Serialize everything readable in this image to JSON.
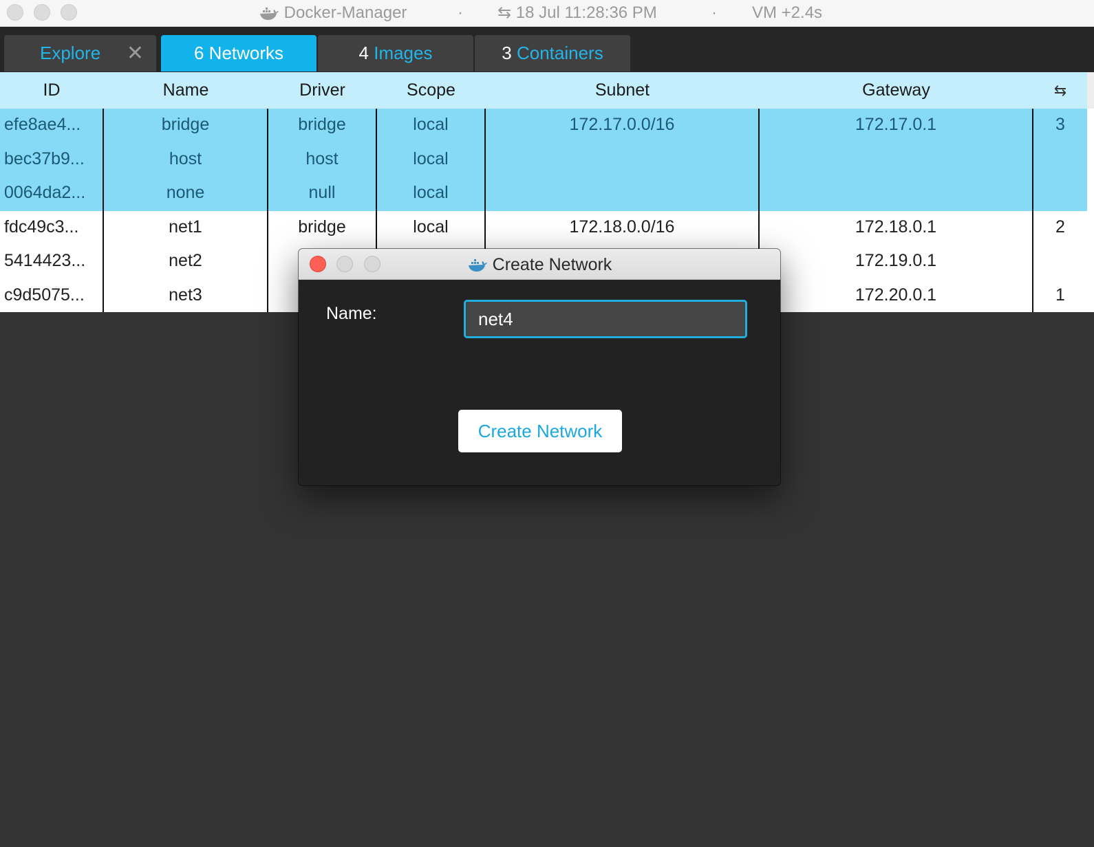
{
  "titlebar": {
    "app_title": "Docker-Manager",
    "separator": "·",
    "sync_icon": "⇆",
    "datetime": "18 Jul 11:28:36 PM",
    "vm_status": "VM +2.4s"
  },
  "tabs": [
    {
      "label": "Explore",
      "close": "✕"
    },
    {
      "count": "6",
      "label": "Networks"
    },
    {
      "count": "4",
      "label": "Images"
    },
    {
      "count": "3",
      "label": "Containers"
    }
  ],
  "table": {
    "columns": [
      "ID",
      "Name",
      "Driver",
      "Scope",
      "Subnet",
      "Gateway",
      "⇆"
    ],
    "rows": [
      {
        "id": "efe8ae4...",
        "name": "bridge",
        "driver": "bridge",
        "scope": "local",
        "subnet": "172.17.0.0/16",
        "gateway": "172.17.0.1",
        "containers": "3",
        "selected": true
      },
      {
        "id": "bec37b9...",
        "name": "host",
        "driver": "host",
        "scope": "local",
        "subnet": "",
        "gateway": "",
        "containers": "",
        "selected": true
      },
      {
        "id": "0064da2...",
        "name": "none",
        "driver": "null",
        "scope": "local",
        "subnet": "",
        "gateway": "",
        "containers": "",
        "selected": true
      },
      {
        "id": "fdc49c3...",
        "name": "net1",
        "driver": "bridge",
        "scope": "local",
        "subnet": "172.18.0.0/16",
        "gateway": "172.18.0.1",
        "containers": "2",
        "selected": false
      },
      {
        "id": "5414423...",
        "name": "net2",
        "driver": "",
        "scope": "",
        "subnet": "",
        "gateway": "172.19.0.1",
        "containers": "",
        "selected": false
      },
      {
        "id": "c9d5075...",
        "name": "net3",
        "driver": "",
        "scope": "",
        "subnet": "",
        "gateway": "172.20.0.1",
        "containers": "1",
        "selected": false
      }
    ]
  },
  "dialog": {
    "title": "Create Network",
    "name_label": "Name:",
    "name_value": "net4",
    "create_button": "Create Network"
  },
  "colors": {
    "accent": "#12b3ea",
    "header_bg": "#c4eefb",
    "selected_row": "#87daf6",
    "background": "#333333",
    "close_red": "#fc5f56"
  }
}
